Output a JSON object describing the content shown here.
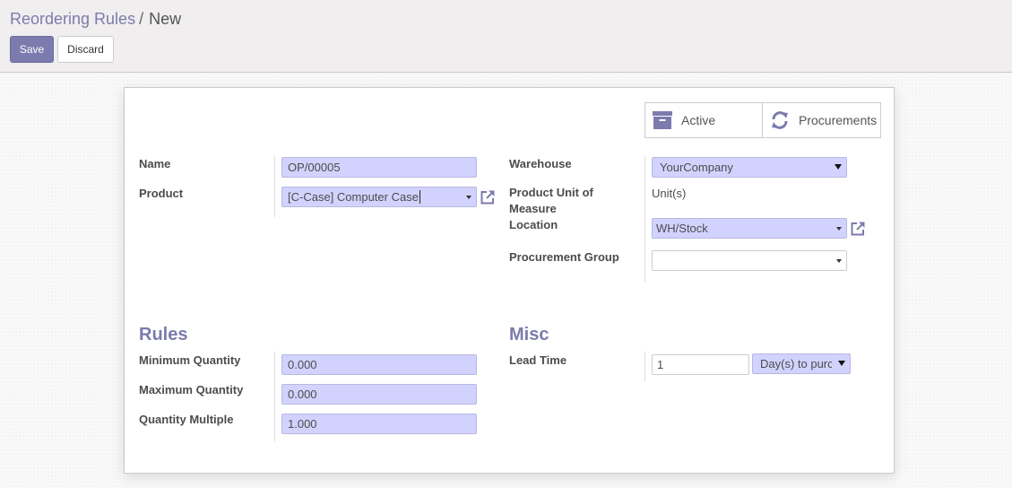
{
  "breadcrumb": {
    "parent": "Reordering Rules",
    "separator": "/",
    "current": "New"
  },
  "toolbar": {
    "save_label": "Save",
    "discard_label": "Discard"
  },
  "button_box": {
    "active": {
      "label": "Active",
      "icon": "archive-icon"
    },
    "procurements": {
      "label": "Procurements",
      "icon": "refresh-icon"
    }
  },
  "left_group": {
    "name": {
      "label": "Name",
      "value": "OP/00005"
    },
    "product": {
      "label": "Product",
      "value": "[C-Case] Computer Case"
    }
  },
  "right_group": {
    "warehouse": {
      "label": "Warehouse",
      "value": "YourCompany"
    },
    "uom": {
      "label_line1": "Product Unit of",
      "label_line2": "Measure",
      "value": "Unit(s)"
    },
    "location": {
      "label": "Location",
      "value": "WH/Stock"
    },
    "procurement_group": {
      "label": "Procurement Group",
      "value": ""
    }
  },
  "rules": {
    "title": "Rules",
    "min_qty": {
      "label": "Minimum Quantity",
      "value": "0.000"
    },
    "max_qty": {
      "label": "Maximum Quantity",
      "value": "0.000"
    },
    "qty_multiple": {
      "label": "Quantity Multiple",
      "value": "1.000"
    }
  },
  "misc": {
    "title": "Misc",
    "lead_time": {
      "label": "Lead Time",
      "value": "1",
      "unit": "Day(s) to purc"
    }
  },
  "colors": {
    "accent": "#7c7bad",
    "required_field": "#d2d2ff"
  }
}
